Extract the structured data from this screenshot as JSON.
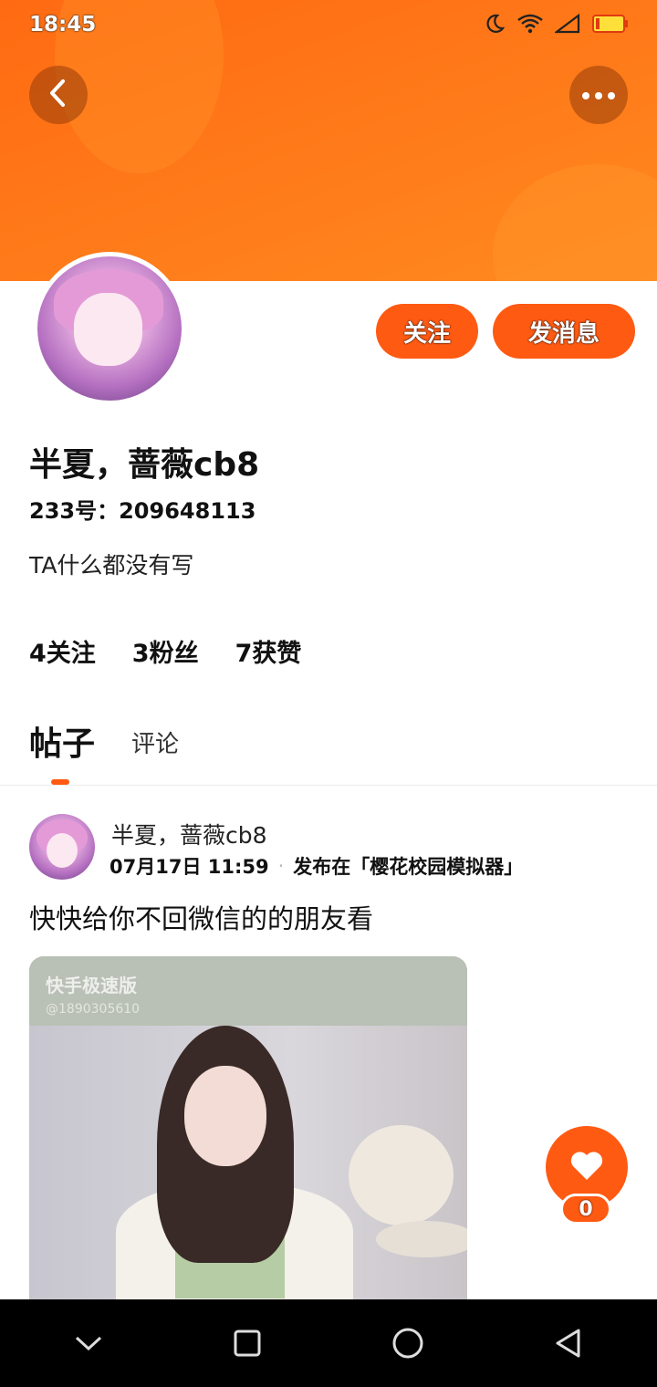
{
  "status_bar": {
    "time": "18:45",
    "icons": [
      "moon-icon",
      "wifi-icon",
      "signal-icon",
      "battery-icon"
    ]
  },
  "header": {
    "back_icon": "back-arrow-icon",
    "more_icon": "more-dots-icon"
  },
  "profile": {
    "follow_label": "关注",
    "message_label": "发消息",
    "username": "半夏，蔷薇cb8",
    "uid": "233号：209648113",
    "bio": "TA什么都没有写",
    "stats": {
      "following": "4关注",
      "fans": "3粉丝",
      "likes": "7获赞"
    }
  },
  "tabs": [
    {
      "label": "帖子",
      "active": true
    },
    {
      "label": "评论",
      "active": false
    }
  ],
  "post": {
    "author": "半夏，蔷薇cb8",
    "date": "07月17日 11:59",
    "published_in": "发布在「樱花校园模拟器」",
    "text": "快快给你不回微信的的朋友看",
    "image_watermark": "快手极速版",
    "image_watermark_id": "@1890305610"
  },
  "like": {
    "count": "0",
    "icon": "heart-icon"
  },
  "nav_bar": {
    "icons": [
      "chevron-down-icon",
      "recent-apps-icon",
      "home-icon",
      "back-triangle-icon"
    ]
  },
  "colors": {
    "accent": "#ff5a12",
    "banner": "#ff7b1a"
  }
}
